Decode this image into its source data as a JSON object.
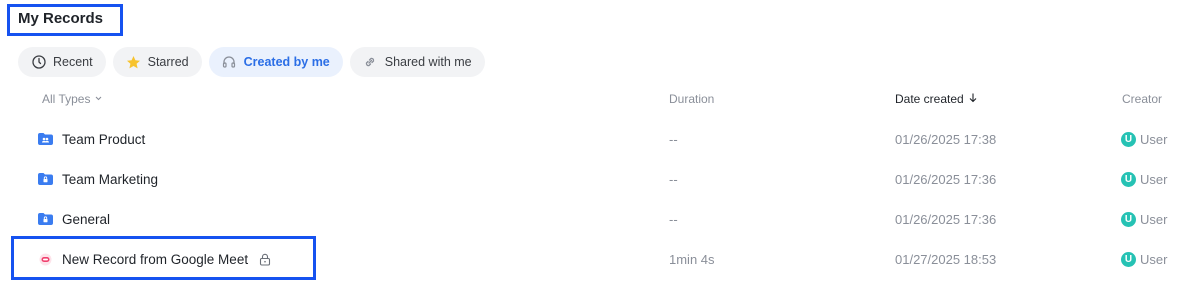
{
  "page": {
    "title": "My Records"
  },
  "tabs": [
    {
      "label": "Recent",
      "icon": "clock-icon",
      "active": false
    },
    {
      "label": "Starred",
      "icon": "star-icon",
      "active": false
    },
    {
      "label": "Created by me",
      "icon": "headphones-icon",
      "active": true
    },
    {
      "label": "Shared with me",
      "icon": "link-icon",
      "active": false
    }
  ],
  "table": {
    "columns": {
      "type_filter": "All Types",
      "duration": "Duration",
      "date_created": "Date created",
      "creator": "Creator"
    },
    "rows": [
      {
        "name": "Team Product",
        "icon": "team-folder-icon",
        "duration": "--",
        "date": "01/26/2025 17:38",
        "creator": "User",
        "creator_initial": "U"
      },
      {
        "name": "Team Marketing",
        "icon": "lock-folder-icon",
        "duration": "--",
        "date": "01/26/2025 17:36",
        "creator": "User",
        "creator_initial": "U"
      },
      {
        "name": "General",
        "icon": "lock-folder-icon",
        "duration": "--",
        "date": "01/26/2025 17:36",
        "creator": "User",
        "creator_initial": "U"
      },
      {
        "name": "New Record from Google Meet",
        "icon": "meeting-record-icon",
        "duration": "1min 4s",
        "date": "01/27/2025 18:53",
        "creator": "User",
        "creator_initial": "U",
        "locked": true
      }
    ]
  },
  "colors": {
    "accent": "#2b6ee6",
    "highlight_box": "#1652f0",
    "folder": "#3a7cf0",
    "record_icon": "#f0406e",
    "avatar": "#26c2b4"
  }
}
